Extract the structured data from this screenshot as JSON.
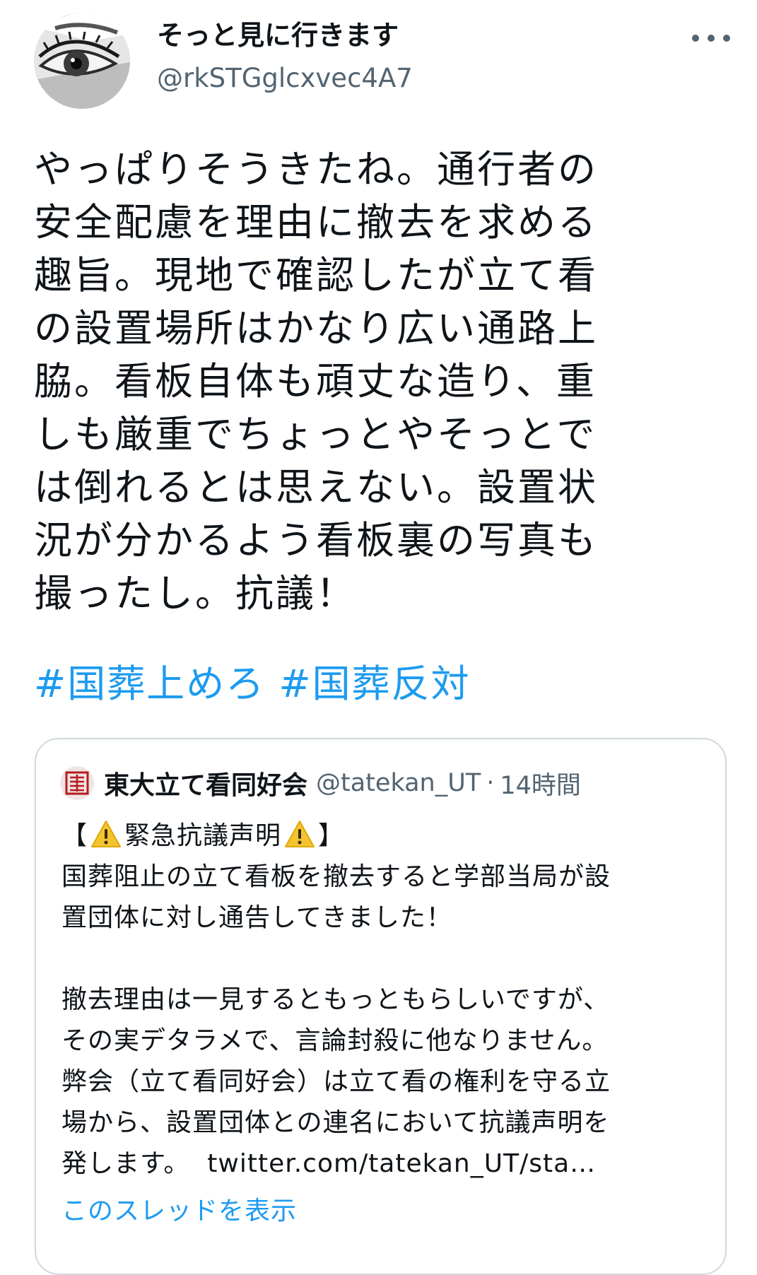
{
  "author": {
    "display_name": "そっと見に行きます",
    "handle": "@rkSTGglcxvec4A7"
  },
  "tweet": {
    "lines": [
      "やっぱりそうきたね。通行者の",
      "安全配慮を理由に撤去を求める",
      "趣旨。現地で確認したが立て看",
      "の設置場所はかなり広い通路上",
      "脇。看板自体も頑丈な造り、重",
      "しも厳重でちょっとやそっとで",
      "は倒れるとは思えない。設置状",
      "況が分かるよう看板裏の写真も",
      "撮ったし。抗議！"
    ],
    "hashtags": [
      "#国葬上めろ",
      "#国葬反対"
    ]
  },
  "quoted": {
    "display_name": "東大立て看同好会",
    "handle": "@tatekan_UT",
    "separator": "·",
    "time": "14時間",
    "title_open": "【",
    "title_text": "緊急抗議声明",
    "title_close": "】",
    "body_lines": [
      "国葬阻止の立て看板を撤去すると学部当局が設",
      "置団体に対し通告してきました！",
      "",
      "撤去理由は一見するともっともらしいですが、",
      "その実デタラメで、言論封殺に他なりません。",
      "弊会（立て看同好会）は立て看の権利を守る立",
      "場から、設置団体との連名において抗議声明を"
    ],
    "last_line_text": "発します。",
    "link_text": "twitter.com/tatekan_UT/sta…",
    "show_thread": "このスレッドを表示"
  },
  "colors": {
    "link": "#1d9bf0",
    "text": "#0f1419",
    "secondary": "#536471",
    "border": "#cfd9de",
    "warning": "#f4c430"
  },
  "icons": {
    "more": "more-horizontal-icon",
    "warning": "warning-triangle-icon"
  }
}
